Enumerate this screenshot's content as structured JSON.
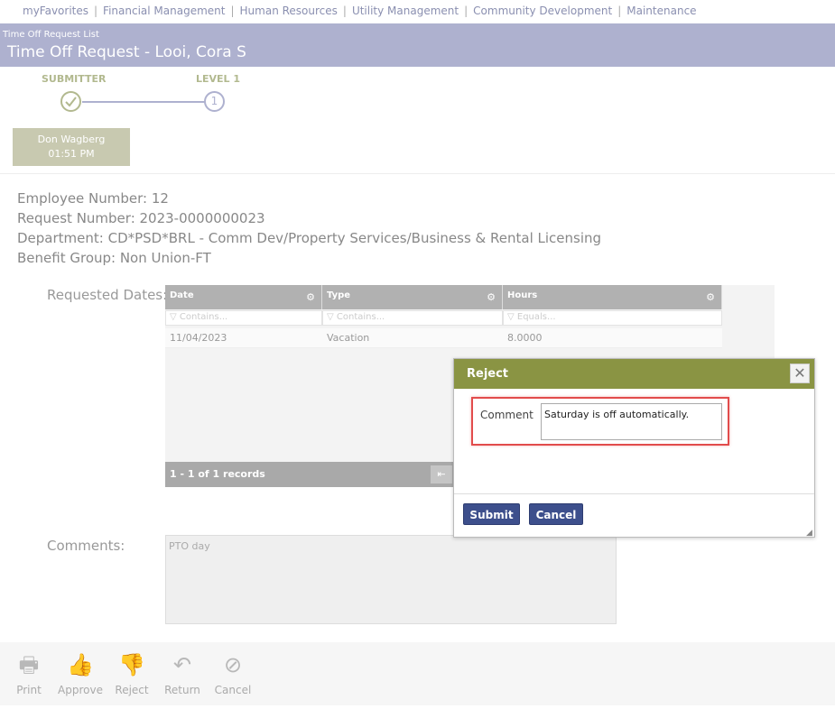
{
  "nav": {
    "items": [
      "myFavorites",
      "Financial Management",
      "Human Resources",
      "Utility Management",
      "Community Development",
      "Maintenance"
    ],
    "separator": "|"
  },
  "header": {
    "breadcrumb": "Time Off Request List",
    "title": "Time Off Request - Looi, Cora S"
  },
  "workflow": {
    "steps": [
      {
        "label": "SUBMITTER",
        "status": "done"
      },
      {
        "label": "LEVEL 1",
        "number": "1"
      }
    ],
    "approver": {
      "name": "Don Wagberg",
      "time": "01:51 PM"
    }
  },
  "info": {
    "employee_number": "Employee Number: 12",
    "request_number": "Request Number: 2023-0000000023",
    "department": "Department: CD*PSD*BRL - Comm Dev/Property Services/Business & Rental Licensing",
    "benefit_group": "Benefit Group: Non Union-FT"
  },
  "requested_dates": {
    "label": "Requested Dates:",
    "columns": [
      {
        "header": "Date",
        "filter": "Contains..."
      },
      {
        "header": "Type",
        "filter": "Contains..."
      },
      {
        "header": "Hours",
        "filter": "Equals..."
      }
    ],
    "rows": [
      [
        "11/04/2023",
        "Vacation",
        "8.0000"
      ]
    ],
    "footer": "1 - 1 of 1 records"
  },
  "comments": {
    "label": "Comments:",
    "value": "PTO day"
  },
  "toolbar": {
    "print": "Print",
    "approve": "Approve",
    "reject": "Reject",
    "return": "Return",
    "cancel": "Cancel"
  },
  "dialog": {
    "title": "Reject",
    "comment_label": "Comment",
    "comment_value": "Saturday is off automatically.",
    "submit": "Submit",
    "cancel": "Cancel"
  },
  "colors": {
    "title_bar": "#aeb1cf",
    "dialog_header": "#8a9443",
    "button": "#3d4f8c",
    "highlight": "#e24c4c"
  }
}
